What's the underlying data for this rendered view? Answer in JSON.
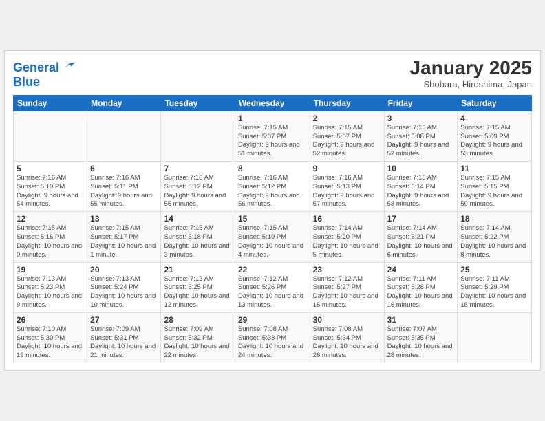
{
  "header": {
    "logo_line1": "General",
    "logo_line2": "Blue",
    "title": "January 2025",
    "subtitle": "Shobara, Hiroshima, Japan"
  },
  "weekdays": [
    "Sunday",
    "Monday",
    "Tuesday",
    "Wednesday",
    "Thursday",
    "Friday",
    "Saturday"
  ],
  "weeks": [
    [
      {
        "day": "",
        "info": ""
      },
      {
        "day": "",
        "info": ""
      },
      {
        "day": "",
        "info": ""
      },
      {
        "day": "1",
        "info": "Sunrise: 7:15 AM\nSunset: 5:07 PM\nDaylight: 9 hours\nand 51 minutes."
      },
      {
        "day": "2",
        "info": "Sunrise: 7:15 AM\nSunset: 5:07 PM\nDaylight: 9 hours\nand 52 minutes."
      },
      {
        "day": "3",
        "info": "Sunrise: 7:15 AM\nSunset: 5:08 PM\nDaylight: 9 hours\nand 52 minutes."
      },
      {
        "day": "4",
        "info": "Sunrise: 7:15 AM\nSunset: 5:09 PM\nDaylight: 9 hours\nand 53 minutes."
      }
    ],
    [
      {
        "day": "5",
        "info": "Sunrise: 7:16 AM\nSunset: 5:10 PM\nDaylight: 9 hours\nand 54 minutes."
      },
      {
        "day": "6",
        "info": "Sunrise: 7:16 AM\nSunset: 5:11 PM\nDaylight: 9 hours\nand 55 minutes."
      },
      {
        "day": "7",
        "info": "Sunrise: 7:16 AM\nSunset: 5:12 PM\nDaylight: 9 hours\nand 55 minutes."
      },
      {
        "day": "8",
        "info": "Sunrise: 7:16 AM\nSunset: 5:12 PM\nDaylight: 9 hours\nand 56 minutes."
      },
      {
        "day": "9",
        "info": "Sunrise: 7:16 AM\nSunset: 5:13 PM\nDaylight: 9 hours\nand 57 minutes."
      },
      {
        "day": "10",
        "info": "Sunrise: 7:15 AM\nSunset: 5:14 PM\nDaylight: 9 hours\nand 58 minutes."
      },
      {
        "day": "11",
        "info": "Sunrise: 7:15 AM\nSunset: 5:15 PM\nDaylight: 9 hours\nand 59 minutes."
      }
    ],
    [
      {
        "day": "12",
        "info": "Sunrise: 7:15 AM\nSunset: 5:16 PM\nDaylight: 10 hours\nand 0 minutes."
      },
      {
        "day": "13",
        "info": "Sunrise: 7:15 AM\nSunset: 5:17 PM\nDaylight: 10 hours\nand 1 minute."
      },
      {
        "day": "14",
        "info": "Sunrise: 7:15 AM\nSunset: 5:18 PM\nDaylight: 10 hours\nand 3 minutes."
      },
      {
        "day": "15",
        "info": "Sunrise: 7:15 AM\nSunset: 5:19 PM\nDaylight: 10 hours\nand 4 minutes."
      },
      {
        "day": "16",
        "info": "Sunrise: 7:14 AM\nSunset: 5:20 PM\nDaylight: 10 hours\nand 5 minutes."
      },
      {
        "day": "17",
        "info": "Sunrise: 7:14 AM\nSunset: 5:21 PM\nDaylight: 10 hours\nand 6 minutes."
      },
      {
        "day": "18",
        "info": "Sunrise: 7:14 AM\nSunset: 5:22 PM\nDaylight: 10 hours\nand 8 minutes."
      }
    ],
    [
      {
        "day": "19",
        "info": "Sunrise: 7:13 AM\nSunset: 5:23 PM\nDaylight: 10 hours\nand 9 minutes."
      },
      {
        "day": "20",
        "info": "Sunrise: 7:13 AM\nSunset: 5:24 PM\nDaylight: 10 hours\nand 10 minutes."
      },
      {
        "day": "21",
        "info": "Sunrise: 7:13 AM\nSunset: 5:25 PM\nDaylight: 10 hours\nand 12 minutes."
      },
      {
        "day": "22",
        "info": "Sunrise: 7:12 AM\nSunset: 5:26 PM\nDaylight: 10 hours\nand 13 minutes."
      },
      {
        "day": "23",
        "info": "Sunrise: 7:12 AM\nSunset: 5:27 PM\nDaylight: 10 hours\nand 15 minutes."
      },
      {
        "day": "24",
        "info": "Sunrise: 7:11 AM\nSunset: 5:28 PM\nDaylight: 10 hours\nand 16 minutes."
      },
      {
        "day": "25",
        "info": "Sunrise: 7:11 AM\nSunset: 5:29 PM\nDaylight: 10 hours\nand 18 minutes."
      }
    ],
    [
      {
        "day": "26",
        "info": "Sunrise: 7:10 AM\nSunset: 5:30 PM\nDaylight: 10 hours\nand 19 minutes."
      },
      {
        "day": "27",
        "info": "Sunrise: 7:09 AM\nSunset: 5:31 PM\nDaylight: 10 hours\nand 21 minutes."
      },
      {
        "day": "28",
        "info": "Sunrise: 7:09 AM\nSunset: 5:32 PM\nDaylight: 10 hours\nand 22 minutes."
      },
      {
        "day": "29",
        "info": "Sunrise: 7:08 AM\nSunset: 5:33 PM\nDaylight: 10 hours\nand 24 minutes."
      },
      {
        "day": "30",
        "info": "Sunrise: 7:08 AM\nSunset: 5:34 PM\nDaylight: 10 hours\nand 26 minutes."
      },
      {
        "day": "31",
        "info": "Sunrise: 7:07 AM\nSunset: 5:35 PM\nDaylight: 10 hours\nand 28 minutes."
      },
      {
        "day": "",
        "info": ""
      }
    ]
  ]
}
